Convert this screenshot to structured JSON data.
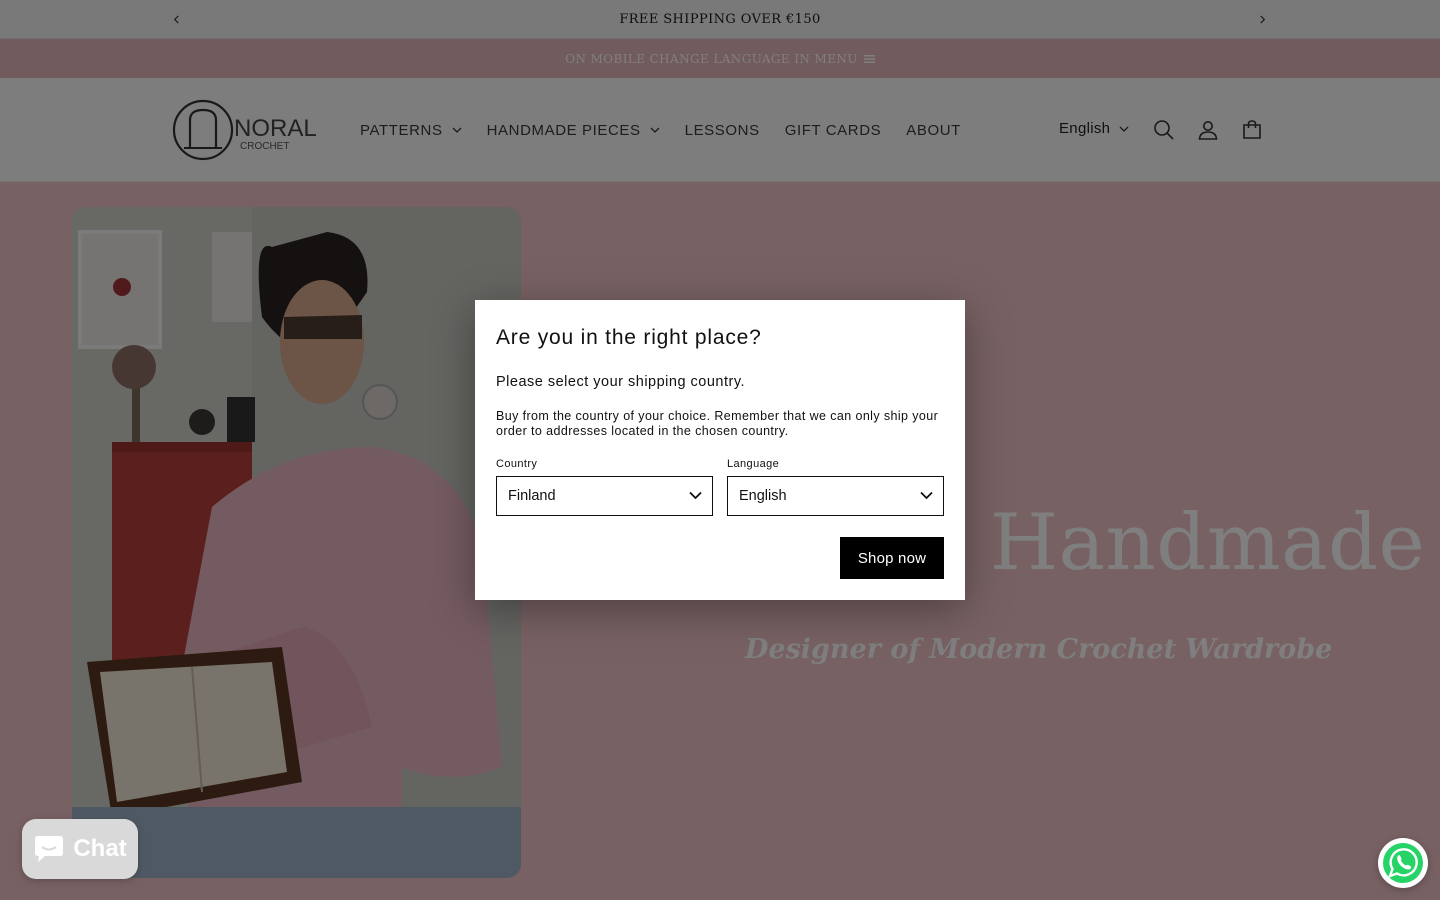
{
  "announcement": {
    "text": "FREE SHIPPING OVER €150",
    "prev_icon": "chevron-left-icon",
    "next_icon": "chevron-right-icon"
  },
  "language_bar": {
    "text": "ON MOBILE CHANGE LANGUAGE IN MENU",
    "icon": "hamburger-icon"
  },
  "header": {
    "logo": {
      "name": "NORAL",
      "tagline": "CROCHET"
    },
    "nav": [
      {
        "label": "PATTERNS",
        "has_dropdown": true
      },
      {
        "label": "HANDMADE PIECES",
        "has_dropdown": true
      },
      {
        "label": "LESSONS",
        "has_dropdown": false
      },
      {
        "label": "GIFT CARDS",
        "has_dropdown": false
      },
      {
        "label": "ABOUT",
        "has_dropdown": false
      }
    ],
    "language": "English",
    "icons": [
      "search-icon",
      "account-icon",
      "cart-icon"
    ]
  },
  "hero": {
    "title": "Handmade",
    "subtitle": "Designer of Modern Crochet Wardrobe"
  },
  "modal": {
    "title": "Are you in the right place?",
    "subtitle": "Please select your shipping country.",
    "body": "Buy from the country of your choice. Remember that we can only ship your order to addresses located in the chosen country.",
    "country_label": "Country",
    "country_value": "Finland",
    "language_label": "Language",
    "language_value": "English",
    "submit_label": "Shop now"
  },
  "chat": {
    "label": "Chat",
    "icon": "chat-bubble-icon"
  },
  "whatsapp": {
    "icon": "whatsapp-icon"
  },
  "colors": {
    "brand_pink": "#f0c2c6",
    "lang_bar": "#e5b6b9",
    "button_black": "#000000",
    "whatsapp_green": "#25d366"
  }
}
